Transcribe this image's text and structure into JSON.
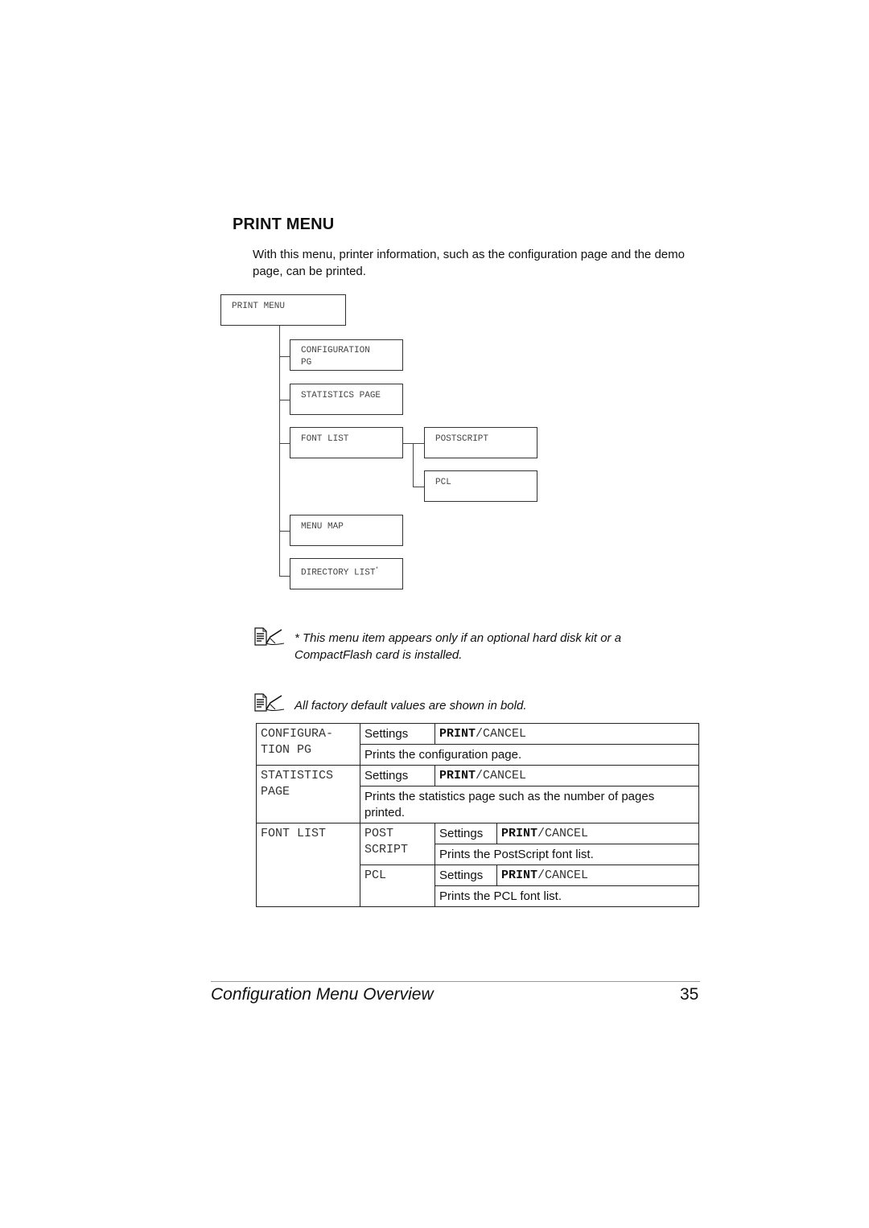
{
  "section": {
    "title": "PRINT MENU",
    "intro": "With this menu, printer information, such as the configuration page and the demo page, can be printed."
  },
  "tree": {
    "root": "PRINT MENU",
    "children": [
      {
        "label_line1": "CONFIGURATION",
        "label_line2": "PG"
      },
      {
        "label_line1": "STATISTICS PAGE"
      },
      {
        "label_line1": "FONT LIST",
        "children": [
          {
            "label": "POSTSCRIPT"
          },
          {
            "label": "PCL"
          }
        ]
      },
      {
        "label_line1": "MENU MAP"
      },
      {
        "label_line1": "DIRECTORY LIST",
        "footnote_mark": "*"
      }
    ]
  },
  "notes": [
    {
      "icon": "note-pencil-icon",
      "text": "* This menu item appears only if an optional hard disk kit or a CompactFlash card is installed."
    },
    {
      "icon": "note-pencil-icon",
      "text": "All factory default values are shown in bold."
    }
  ],
  "table": {
    "config_pg": {
      "name_line1": "CONFIGURA-",
      "name_line2": "TION PG",
      "settings_label": "Settings",
      "default_value": "PRINT",
      "separator": "/",
      "other_value": "CANCEL",
      "description": "Prints the configuration page."
    },
    "statistics_page": {
      "name_line1": "STATISTICS",
      "name_line2": "PAGE",
      "settings_label": "Settings",
      "default_value": "PRINT",
      "separator": "/",
      "other_value": "CANCEL",
      "description": "Prints the statistics page such as the number of pages printed."
    },
    "font_list": {
      "name": "FONT LIST",
      "postscript": {
        "name_line1": "POST",
        "name_line2": "SCRIPT",
        "settings_label": "Settings",
        "default_value": "PRINT",
        "separator": "/",
        "other_value": "CANCEL",
        "description": "Prints the PostScript font list."
      },
      "pcl": {
        "name": "PCL",
        "settings_label": "Settings",
        "default_value": "PRINT",
        "separator": "/",
        "other_value": "CANCEL",
        "description": "Prints the PCL font list."
      }
    }
  },
  "footer": {
    "title": "Configuration Menu Overview",
    "page_number": "35"
  }
}
